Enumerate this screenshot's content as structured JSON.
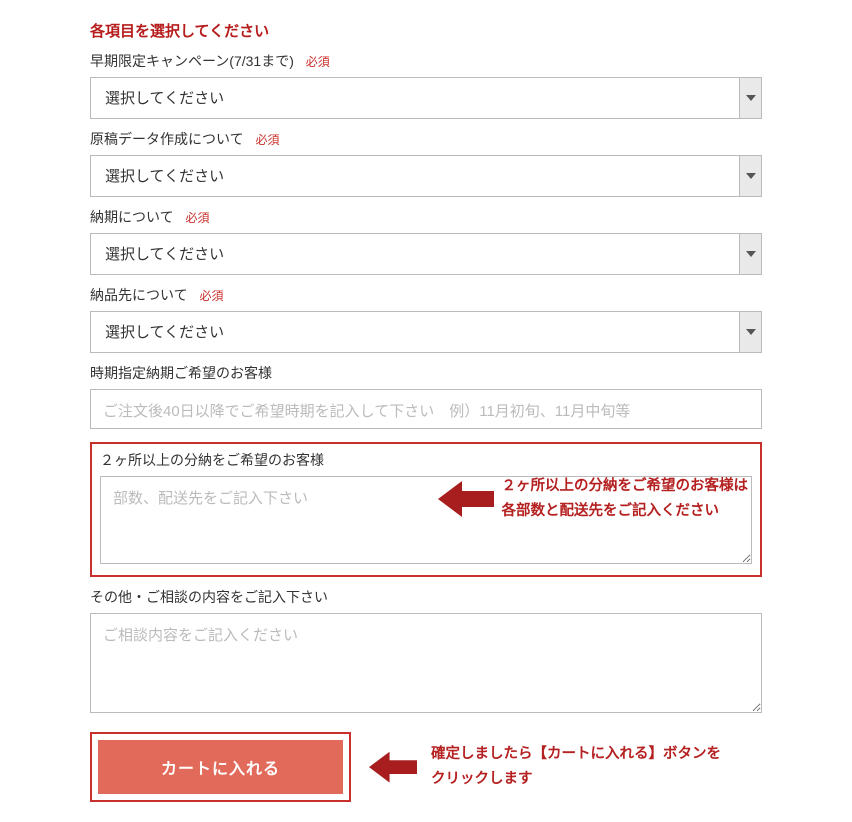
{
  "title": "各項目を選択してください",
  "required_label": "必須",
  "select_placeholder": "選択してください",
  "fields": {
    "campaign": {
      "label": "早期限定キャンペーン(7/31まで)"
    },
    "manuscript": {
      "label": "原稿データ作成について"
    },
    "delivery_time": {
      "label": "納期について"
    },
    "delivery_dest": {
      "label": "納品先について"
    },
    "specific_date": {
      "label": "時期指定納期ご希望のお客様",
      "placeholder": "ご注文後40日以降でご希望時期を記入して下さい　例）11月初旬、11月中旬等"
    },
    "split_delivery": {
      "label": "２ヶ所以上の分納をご希望のお客様",
      "placeholder": "部数、配送先をご記入下さい",
      "annotation_line1": "２ヶ所以上の分納をご希望のお客様は",
      "annotation_line2": "各部数と配送先をご記入ください"
    },
    "other": {
      "label": "その他・ご相談の内容をご記入下さい",
      "placeholder": "ご相談内容をご記入ください"
    }
  },
  "submit": {
    "button_label": "カートに入れる",
    "annotation_line1": "確定しましたら【カートに入れる】ボタンを",
    "annotation_line2": "クリックします"
  },
  "colors": {
    "accent": "#b71c1c",
    "button": "#e26a5a"
  }
}
